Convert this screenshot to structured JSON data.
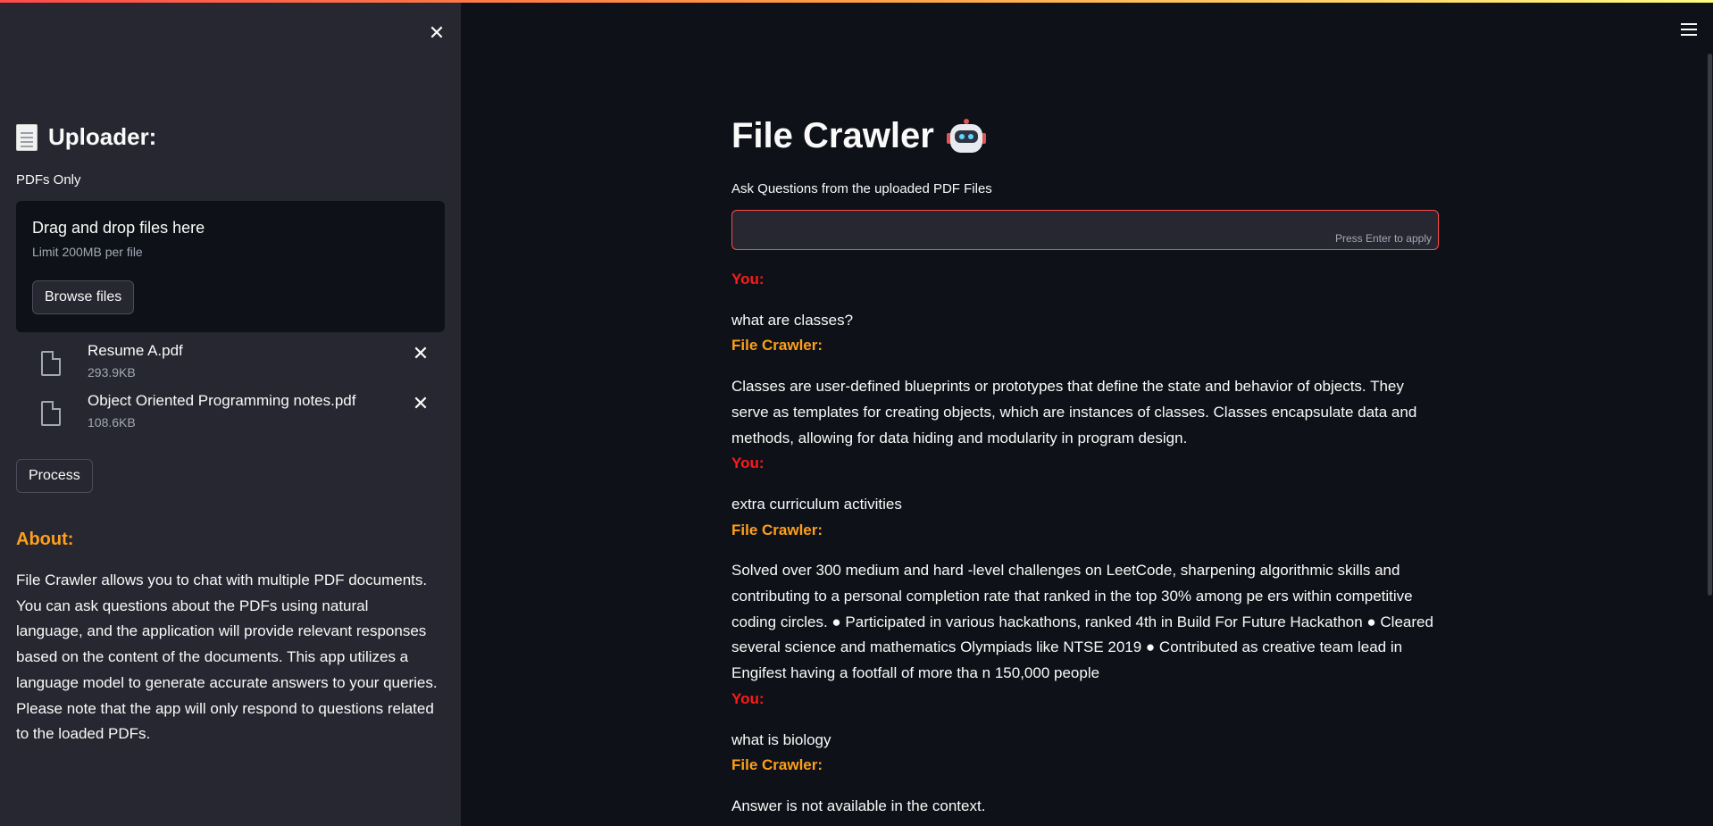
{
  "sidebar": {
    "title": "Uploader:",
    "pdf_label": "PDFs Only",
    "dropzone": {
      "title": "Drag and drop files here",
      "limit": "Limit 200MB per file",
      "browse_label": "Browse files"
    },
    "files": [
      {
        "name": "Resume A.pdf",
        "size": "293.9KB"
      },
      {
        "name": "Object Oriented Programming notes.pdf",
        "size": "108.6KB"
      }
    ],
    "process_label": "Process",
    "about_heading": "About:",
    "about_text": "File Crawler allows you to chat with multiple PDF documents. You can ask questions about the PDFs using natural language, and the application will provide relevant responses based on the content of the documents. This app utilizes a language model to generate accurate answers to your queries. Please note that the app will only respond to questions related to the loaded PDFs."
  },
  "main": {
    "title": "File Crawler",
    "ask_label": "Ask Questions from the uploaded PDF Files",
    "input_value": "",
    "input_hint": "Press Enter to apply",
    "you_label": "You:",
    "bot_label": "File Crawler:",
    "messages": [
      {
        "question": "what are classes?",
        "answer": "Classes are user-defined blueprints or prototypes that define the state and behavior of objects. They serve as templates for creating objects, which are instances of classes. Classes encapsulate data and methods, allowing for data hiding and modularity in program design."
      },
      {
        "question": "extra curriculum activities",
        "answer": "Solved over 300 medium and hard -level challenges on LeetCode, sharpening algorithmic skills and contributing to a personal completion rate that ranked in the top 30% among pe ers within competitive coding circles. ● Participated in various hackathons, ranked 4th in Build For Future Hackathon ● Cleared several science and mathematics Olympiads like NTSE 2019 ● Contributed as creative team lead in Engifest having a footfall of more tha n 150,000 people"
      },
      {
        "question": "what is biology",
        "answer": "Answer is not available in the context."
      }
    ]
  },
  "colors": {
    "background": "#0e1117",
    "sidebar": "#262730",
    "you_label": "#ff1a1a",
    "bot_label": "#ff9f1a",
    "input_border": "#ff4b4b"
  },
  "icons": {
    "close_sidebar": "close-icon",
    "menu": "hamburger-menu-icon",
    "uploader": "document-icon",
    "file": "file-icon",
    "title": "robot-icon"
  }
}
